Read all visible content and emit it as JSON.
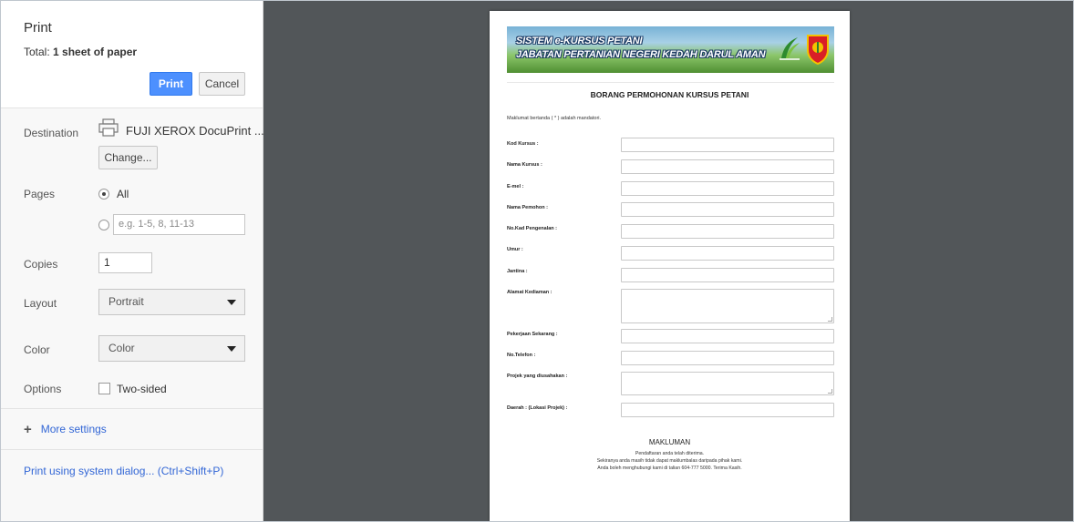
{
  "sidebar": {
    "title": "Print",
    "total_prefix": "Total:",
    "total_value": "1 sheet of paper",
    "print_button": "Print",
    "cancel_button": "Cancel",
    "destination_label": "Destination",
    "destination_name": "FUJI XEROX DocuPrint ...",
    "change_button": "Change...",
    "pages_label": "Pages",
    "pages_all": "All",
    "pages_placeholder": "e.g. 1-5, 8, 11-13",
    "copies_label": "Copies",
    "copies_value": "1",
    "layout_label": "Layout",
    "layout_value": "Portrait",
    "color_label": "Color",
    "color_value": "Color",
    "options_label": "Options",
    "two_sided_label": "Two-sided",
    "more_settings": "More settings",
    "system_dialog": "Print using system dialog... (Ctrl+Shift+P)"
  },
  "colors": {
    "accent": "#4d90fe",
    "link": "#3367d6",
    "preview_bg": "#525659"
  },
  "document": {
    "banner_line1": "SISTEM e-KURSUS PETANI",
    "banner_line2": "JABATAN PERTANIAN NEGERI KEDAH DARUL AMAN",
    "form_title": "BORANG PERMOHONAN KURSUS PETANI",
    "mandatory_note": "Maklumat bertanda ( * ) adalah mandatori.",
    "fields": [
      "Kod Kursus :",
      "Nama Kursus :",
      "E-mel :",
      "Nama Pemohon :",
      "No.Kad Pengenalan :",
      "Umur :",
      "Jantina :",
      "Alamat Kediaman :",
      "Pekerjaan Sekarang :",
      "No.Telefon :",
      "Projek yang diusahakan :",
      "Daerah : (Lokasi Projek) :"
    ],
    "makluman_title": "MAKLUMAN",
    "makluman_lines": [
      "Pendaftaran anda telah diterima.",
      "Sekiranya anda masih tidak dapat maklumbalas daripada pihak kami.",
      "Anda boleh menghubungi kami di talian 604-777 5000. Terima Kasih."
    ]
  }
}
